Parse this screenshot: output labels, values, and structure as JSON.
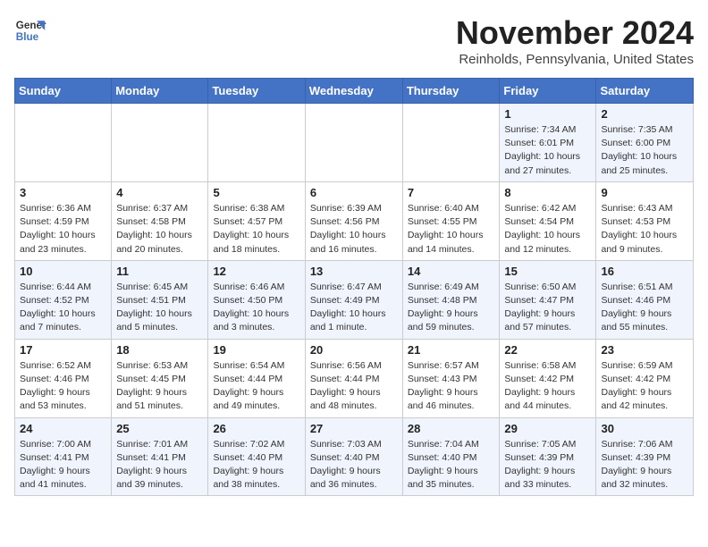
{
  "header": {
    "logo_line1": "General",
    "logo_line2": "Blue",
    "month": "November 2024",
    "location": "Reinholds, Pennsylvania, United States"
  },
  "weekdays": [
    "Sunday",
    "Monday",
    "Tuesday",
    "Wednesday",
    "Thursday",
    "Friday",
    "Saturday"
  ],
  "weeks": [
    [
      {
        "day": "",
        "info": ""
      },
      {
        "day": "",
        "info": ""
      },
      {
        "day": "",
        "info": ""
      },
      {
        "day": "",
        "info": ""
      },
      {
        "day": "",
        "info": ""
      },
      {
        "day": "1",
        "info": "Sunrise: 7:34 AM\nSunset: 6:01 PM\nDaylight: 10 hours and 27 minutes."
      },
      {
        "day": "2",
        "info": "Sunrise: 7:35 AM\nSunset: 6:00 PM\nDaylight: 10 hours and 25 minutes."
      }
    ],
    [
      {
        "day": "3",
        "info": "Sunrise: 6:36 AM\nSunset: 4:59 PM\nDaylight: 10 hours and 23 minutes."
      },
      {
        "day": "4",
        "info": "Sunrise: 6:37 AM\nSunset: 4:58 PM\nDaylight: 10 hours and 20 minutes."
      },
      {
        "day": "5",
        "info": "Sunrise: 6:38 AM\nSunset: 4:57 PM\nDaylight: 10 hours and 18 minutes."
      },
      {
        "day": "6",
        "info": "Sunrise: 6:39 AM\nSunset: 4:56 PM\nDaylight: 10 hours and 16 minutes."
      },
      {
        "day": "7",
        "info": "Sunrise: 6:40 AM\nSunset: 4:55 PM\nDaylight: 10 hours and 14 minutes."
      },
      {
        "day": "8",
        "info": "Sunrise: 6:42 AM\nSunset: 4:54 PM\nDaylight: 10 hours and 12 minutes."
      },
      {
        "day": "9",
        "info": "Sunrise: 6:43 AM\nSunset: 4:53 PM\nDaylight: 10 hours and 9 minutes."
      }
    ],
    [
      {
        "day": "10",
        "info": "Sunrise: 6:44 AM\nSunset: 4:52 PM\nDaylight: 10 hours and 7 minutes."
      },
      {
        "day": "11",
        "info": "Sunrise: 6:45 AM\nSunset: 4:51 PM\nDaylight: 10 hours and 5 minutes."
      },
      {
        "day": "12",
        "info": "Sunrise: 6:46 AM\nSunset: 4:50 PM\nDaylight: 10 hours and 3 minutes."
      },
      {
        "day": "13",
        "info": "Sunrise: 6:47 AM\nSunset: 4:49 PM\nDaylight: 10 hours and 1 minute."
      },
      {
        "day": "14",
        "info": "Sunrise: 6:49 AM\nSunset: 4:48 PM\nDaylight: 9 hours and 59 minutes."
      },
      {
        "day": "15",
        "info": "Sunrise: 6:50 AM\nSunset: 4:47 PM\nDaylight: 9 hours and 57 minutes."
      },
      {
        "day": "16",
        "info": "Sunrise: 6:51 AM\nSunset: 4:46 PM\nDaylight: 9 hours and 55 minutes."
      }
    ],
    [
      {
        "day": "17",
        "info": "Sunrise: 6:52 AM\nSunset: 4:46 PM\nDaylight: 9 hours and 53 minutes."
      },
      {
        "day": "18",
        "info": "Sunrise: 6:53 AM\nSunset: 4:45 PM\nDaylight: 9 hours and 51 minutes."
      },
      {
        "day": "19",
        "info": "Sunrise: 6:54 AM\nSunset: 4:44 PM\nDaylight: 9 hours and 49 minutes."
      },
      {
        "day": "20",
        "info": "Sunrise: 6:56 AM\nSunset: 4:44 PM\nDaylight: 9 hours and 48 minutes."
      },
      {
        "day": "21",
        "info": "Sunrise: 6:57 AM\nSunset: 4:43 PM\nDaylight: 9 hours and 46 minutes."
      },
      {
        "day": "22",
        "info": "Sunrise: 6:58 AM\nSunset: 4:42 PM\nDaylight: 9 hours and 44 minutes."
      },
      {
        "day": "23",
        "info": "Sunrise: 6:59 AM\nSunset: 4:42 PM\nDaylight: 9 hours and 42 minutes."
      }
    ],
    [
      {
        "day": "24",
        "info": "Sunrise: 7:00 AM\nSunset: 4:41 PM\nDaylight: 9 hours and 41 minutes."
      },
      {
        "day": "25",
        "info": "Sunrise: 7:01 AM\nSunset: 4:41 PM\nDaylight: 9 hours and 39 minutes."
      },
      {
        "day": "26",
        "info": "Sunrise: 7:02 AM\nSunset: 4:40 PM\nDaylight: 9 hours and 38 minutes."
      },
      {
        "day": "27",
        "info": "Sunrise: 7:03 AM\nSunset: 4:40 PM\nDaylight: 9 hours and 36 minutes."
      },
      {
        "day": "28",
        "info": "Sunrise: 7:04 AM\nSunset: 4:40 PM\nDaylight: 9 hours and 35 minutes."
      },
      {
        "day": "29",
        "info": "Sunrise: 7:05 AM\nSunset: 4:39 PM\nDaylight: 9 hours and 33 minutes."
      },
      {
        "day": "30",
        "info": "Sunrise: 7:06 AM\nSunset: 4:39 PM\nDaylight: 9 hours and 32 minutes."
      }
    ]
  ]
}
